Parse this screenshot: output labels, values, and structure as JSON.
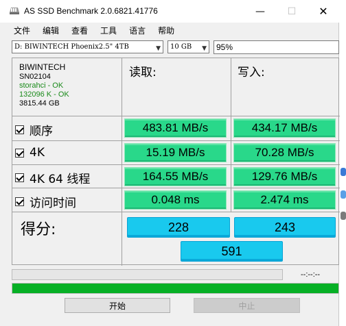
{
  "window": {
    "title": "AS SSD Benchmark 2.0.6821.41776",
    "minimize_glyph": "—",
    "maximize_glyph": "☐",
    "close_glyph": "✕"
  },
  "menu": [
    "文件",
    "编辑",
    "查看",
    "工具",
    "语言",
    "帮助"
  ],
  "selectors": {
    "drive": "D: BIWINTECH Phoenix2.5\" 4TB",
    "size": "10 GB",
    "percent": "95%"
  },
  "drive_info": {
    "model": "BIWINTECH",
    "serial": "SN02104",
    "driver": "storahci - OK",
    "alignment": "132096 K - OK",
    "capacity": "3815.44 GB"
  },
  "columns": {
    "read": "读取:",
    "write": "写入:"
  },
  "rows": [
    {
      "label": "顺序",
      "read": "483.81 MB/s",
      "write": "434.17 MB/s"
    },
    {
      "label": "4K",
      "read": "15.19 MB/s",
      "write": "70.28 MB/s"
    },
    {
      "label": "4K 64 线程",
      "read": "164.55 MB/s",
      "write": "129.76 MB/s"
    },
    {
      "label": "访问时间",
      "read": "0.048 ms",
      "write": "2.474 ms"
    }
  ],
  "score": {
    "label": "得分:",
    "read": "228",
    "write": "243",
    "total": "591"
  },
  "progress": {
    "elapsed": "--:--:--",
    "main_fraction": 1.0,
    "top_fraction": 0.0
  },
  "buttons": {
    "start": "开始",
    "stop": "中止"
  },
  "colors": {
    "result_green": "#29d88a",
    "score_blue": "#19c9ee",
    "progress_green": "#06b025"
  }
}
